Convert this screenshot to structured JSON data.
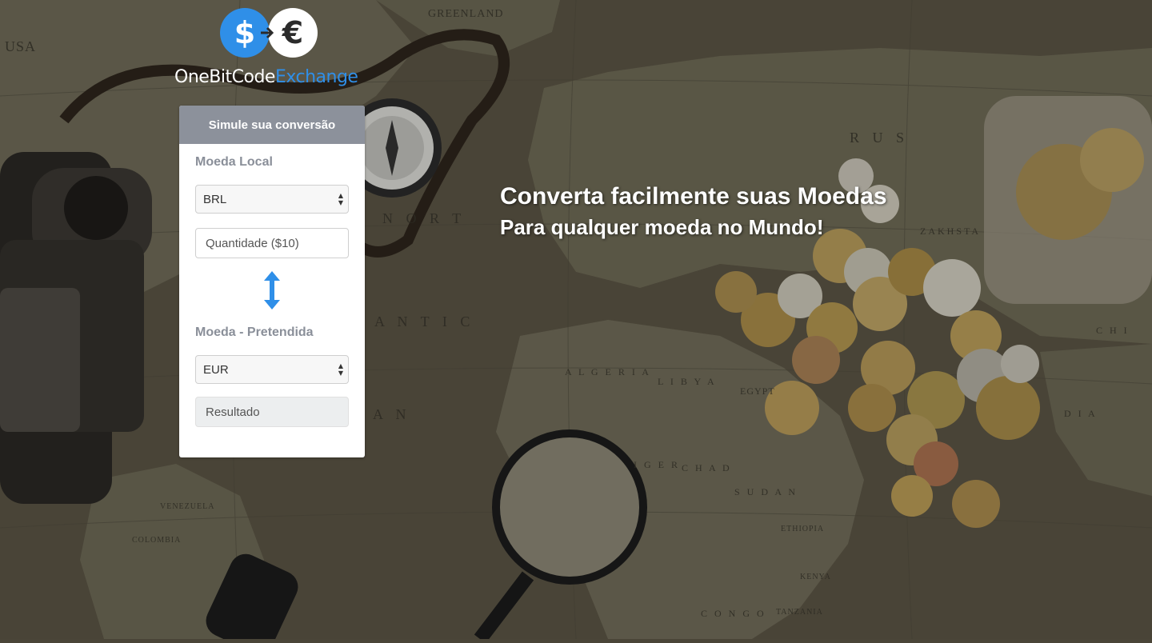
{
  "logo": {
    "dollar_symbol": "$",
    "euro_symbol": "€",
    "brand_main": "OneBitCode",
    "brand_accent": "Exchange"
  },
  "converter": {
    "title": "Simule sua conversão",
    "local_currency_label": "Moeda Local",
    "local_currency_value": "BRL",
    "amount_placeholder": "Quantidade ($10)",
    "target_currency_label": "Moeda - Pretendida",
    "target_currency_value": "EUR",
    "result_placeholder": "Resultado"
  },
  "hero": {
    "title": "Converta facilmente suas Moedas",
    "subtitle": "Para qualquer moeda no Mundo!"
  },
  "background_map_labels": {
    "greenland": "GREENLAND",
    "usa": "USA",
    "russia": "R U S",
    "kazakhstan": "ZAKHSTA",
    "north": "N O R T",
    "atlantic": "A N T I C",
    "ocean": "A N",
    "algeria": "A L G E R I A",
    "libya": "L I B Y A",
    "egypt": "EGYPT",
    "chad": "C H A D",
    "niger": "I G E R",
    "sudan": "S U D A N",
    "ethiopia": "ETHIOPIA",
    "kenya": "KENYA",
    "tanzania": "TANZANIA",
    "congo": "C O N G O",
    "india": "D I A",
    "china": "C H I",
    "venezuela": "VENEZUELA",
    "colombia": "COLOMBIA"
  },
  "colors": {
    "accent_blue": "#2f8fe8",
    "card_header": "#8c919b",
    "label_gray": "#8a8f99"
  }
}
